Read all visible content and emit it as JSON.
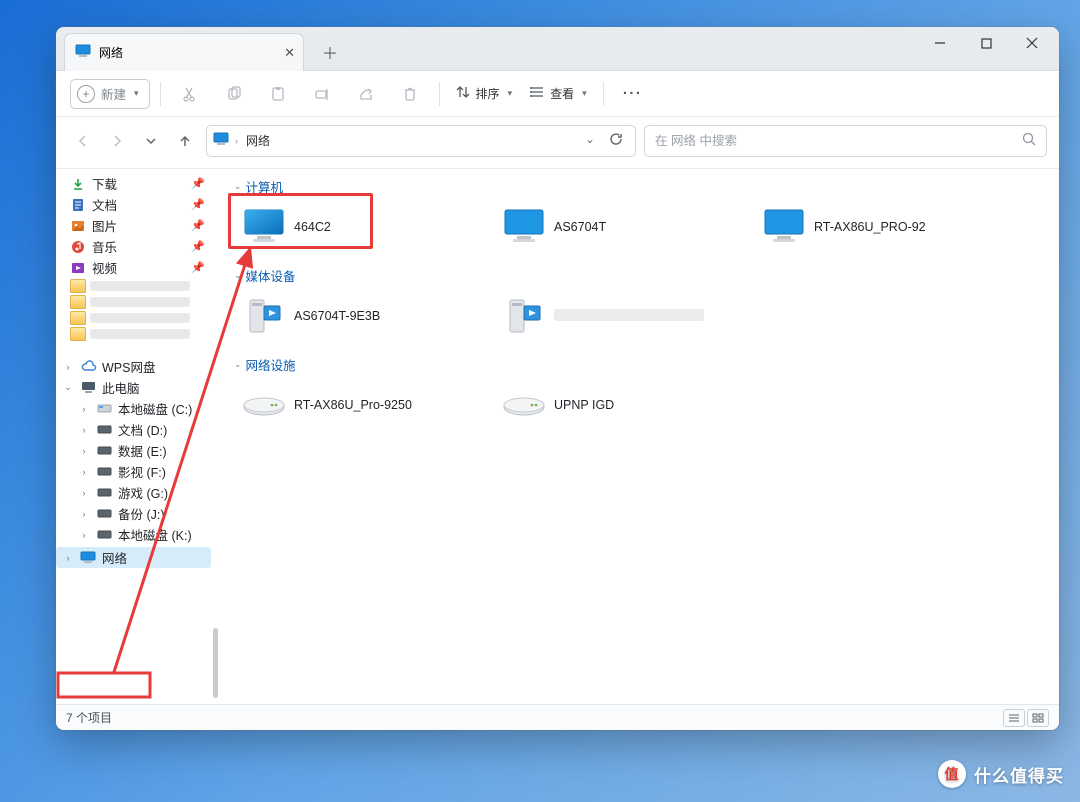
{
  "window": {
    "tab_title": "网络",
    "toolbar": {
      "new_label": "新建",
      "sort_label": "排序",
      "view_label": "查看"
    },
    "breadcrumb": {
      "root_label": "网络"
    },
    "search": {
      "placeholder": "在 网络 中搜索"
    },
    "statusbar": {
      "items_label": "7 个项目"
    }
  },
  "nav": {
    "quick": {
      "downloads": "下载",
      "documents": "文档",
      "pictures": "图片",
      "music": "音乐",
      "videos": "视频"
    },
    "wps": "WPS网盘",
    "thispc": "此电脑",
    "drives": {
      "c": "本地磁盘 (C:)",
      "d": "文档 (D:)",
      "e": "数据 (E:)",
      "f": "影视 (F:)",
      "g": "游戏 (G:)",
      "j": "备份 (J:)",
      "k": "本地磁盘 (K:)"
    },
    "network": "网络"
  },
  "content": {
    "groups": {
      "computers": {
        "label": "计算机",
        "items": [
          {
            "label": "464C2"
          },
          {
            "label": "AS6704T"
          },
          {
            "label": "RT-AX86U_PRO-92"
          }
        ]
      },
      "media": {
        "label": "媒体设备",
        "items": [
          {
            "label": "AS6704T-9E3B"
          },
          {
            "label": ""
          }
        ]
      },
      "netinfra": {
        "label": "网络设施",
        "items": [
          {
            "label": "RT-AX86U_Pro-9250"
          },
          {
            "label": "UPNP IGD"
          }
        ]
      }
    }
  },
  "watermark": {
    "badge": "值",
    "text": "什么值得买"
  }
}
